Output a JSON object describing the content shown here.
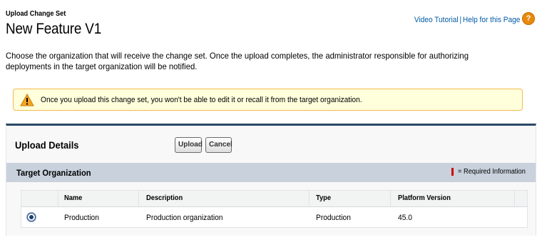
{
  "header": {
    "page_type": "Upload Change Set",
    "title": "New Feature V1",
    "video_tutorial": "Video Tutorial",
    "separator": "|",
    "help_link": "Help for this Page",
    "help_icon": "?"
  },
  "intro": "Choose the organization that will receive the change set. Once the upload completes, the administrator responsible for authorizing deployments in the target organization will be notified.",
  "warning": {
    "icon": "warning-triangle-icon",
    "text": "Once you upload this change set, you won't be able to edit it or recall it from the target organization."
  },
  "upload": {
    "title": "Upload Details",
    "upload_button": "Upload",
    "cancel_button": "Cancel"
  },
  "target": {
    "title": "Target Organization",
    "required_label": "= Required Information",
    "columns": [
      "Name",
      "Description",
      "Type",
      "Platform Version"
    ],
    "rows": [
      {
        "selected": true,
        "name": "Production",
        "description": "Production organization",
        "type": "Production",
        "platform_version": "45.0"
      }
    ]
  },
  "colors": {
    "link": "#015ba7",
    "section_border": "#2a4864",
    "subheader_bg": "#c8d1dc",
    "warning_bg": "#ffffdc",
    "warning_border": "#f2ba4c",
    "required_marker": "#cc0000"
  }
}
